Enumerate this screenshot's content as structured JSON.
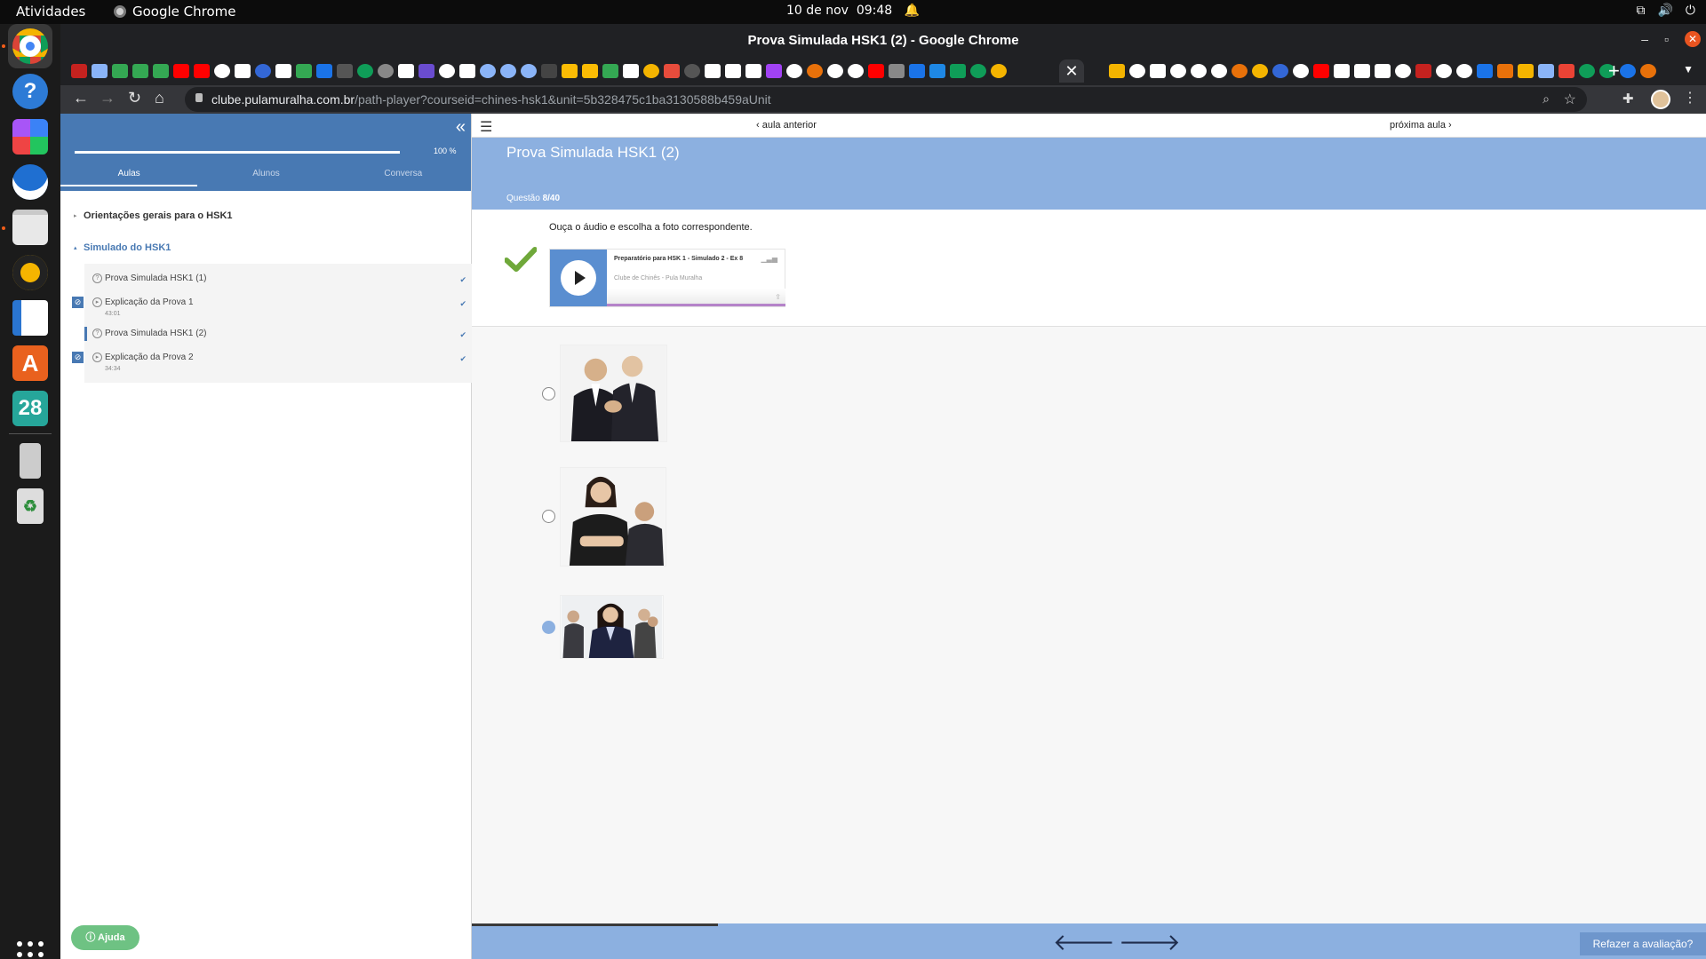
{
  "os": {
    "activities": "Atividades",
    "app_name": "Google Chrome",
    "clock_date": "10 de nov",
    "clock_time": "09:48",
    "dock_calendar_day": "28"
  },
  "browser": {
    "window_title": "Prova Simulada HSK1 (2) - Google Chrome",
    "url_host": "clube.pulamuralha.com.br",
    "url_path": "/path-player?courseid=chines-hsk1&unit=5b328475c1ba3130588b459aUnit"
  },
  "sidebar": {
    "progress_percent": 100,
    "progress_label": "100 %",
    "tabs": [
      "Aulas",
      "Alunos",
      "Conversa"
    ],
    "active_tab": "Aulas",
    "sections": [
      {
        "label": "Orientações gerais para o HSK1",
        "open": false
      },
      {
        "label": "Simulado do HSK1",
        "open": true
      }
    ],
    "lessons": [
      {
        "name": "Prova Simulada HSK1 (1)",
        "duration": "",
        "type": "quiz",
        "done": true
      },
      {
        "name": "Explicação da Prova 1",
        "duration": "43:01",
        "type": "video",
        "done": true
      },
      {
        "name": "Prova Simulada HSK1 (2)",
        "duration": "",
        "type": "quiz",
        "done": true,
        "current": true
      },
      {
        "name": "Explicação da Prova 2",
        "duration": "34:34",
        "type": "video",
        "done": true
      }
    ],
    "help_button": "Ajuda"
  },
  "main": {
    "prev_lesson": "aula anterior",
    "next_lesson": "próxima aula",
    "quiz_title": "Prova Simulada HSK1 (2)",
    "question_label": "Questão",
    "question_number": "8/40",
    "prompt": "Ouça o áudio e escolha a foto correspondente.",
    "player": {
      "track_title": "Preparatório para HSK 1 - Simulado 2 - Ex 8",
      "artist": "Clube de Chinês - Pula Muralha"
    },
    "options": [
      {
        "alt": "Dois homens de terno apertando as mãos",
        "selected": false
      },
      {
        "alt": "Mulher de braços cruzados e homem ao fundo",
        "selected": false
      },
      {
        "alt": "Mulher em reunião com colegas",
        "selected": true
      }
    ],
    "redo_button": "Refazer a avaliação?",
    "colors": {
      "accent": "#4879b3",
      "header": "#8cb0e0",
      "check": "#6fa83a"
    }
  }
}
